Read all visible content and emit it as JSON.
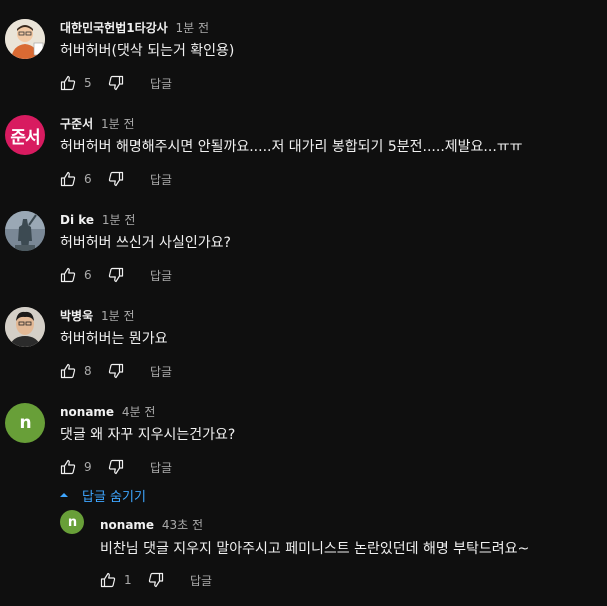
{
  "comments": [
    {
      "author": "대한민국헌법1타강사",
      "time": "1분 전",
      "text": "허버허버(댓삭 되는거 확인용)",
      "likes": "5",
      "reply_label": "답글",
      "avatar": {
        "type": "photo-illustration",
        "bg": "#e8e2d6"
      }
    },
    {
      "author": "구준서",
      "time": "1분 전",
      "text": "허버허버 해명해주시면 안될까요.....저 대가리 봉합되기 5분전.....제발요...ㅠㅠ",
      "likes": "6",
      "reply_label": "답글",
      "avatar": {
        "type": "text",
        "text": "준서",
        "bg": "#d81b60"
      }
    },
    {
      "author": "Di ke",
      "time": "1분 전",
      "text": "허버허버 쓰신거 사실인가요?",
      "likes": "6",
      "reply_label": "답글",
      "avatar": {
        "type": "photo-statue",
        "bg": "#6f7f8d"
      }
    },
    {
      "author": "박병욱",
      "time": "1분 전",
      "text": "허버허버는 뭔가요",
      "likes": "8",
      "reply_label": "답글",
      "avatar": {
        "type": "photo-person",
        "bg": "#cfcac2"
      }
    },
    {
      "author": "noname",
      "time": "4분 전",
      "text": "댓글 왜 자꾸 지우시는건가요?",
      "likes": "9",
      "reply_label": "답글",
      "avatar": {
        "type": "letter",
        "text": "n",
        "bg": "#689f38"
      }
    }
  ],
  "replies_toggle": {
    "label": "답글 숨기기",
    "color": "#3ea6ff"
  },
  "reply": {
    "author": "noname",
    "time": "43초 전",
    "text": "비찬님 댓글 지우지 말아주시고 페미니스트 논란있던데 해명 부탁드려요~",
    "likes": "1",
    "reply_label": "답글",
    "avatar": {
      "type": "letter",
      "text": "n",
      "bg": "#689f38"
    }
  }
}
